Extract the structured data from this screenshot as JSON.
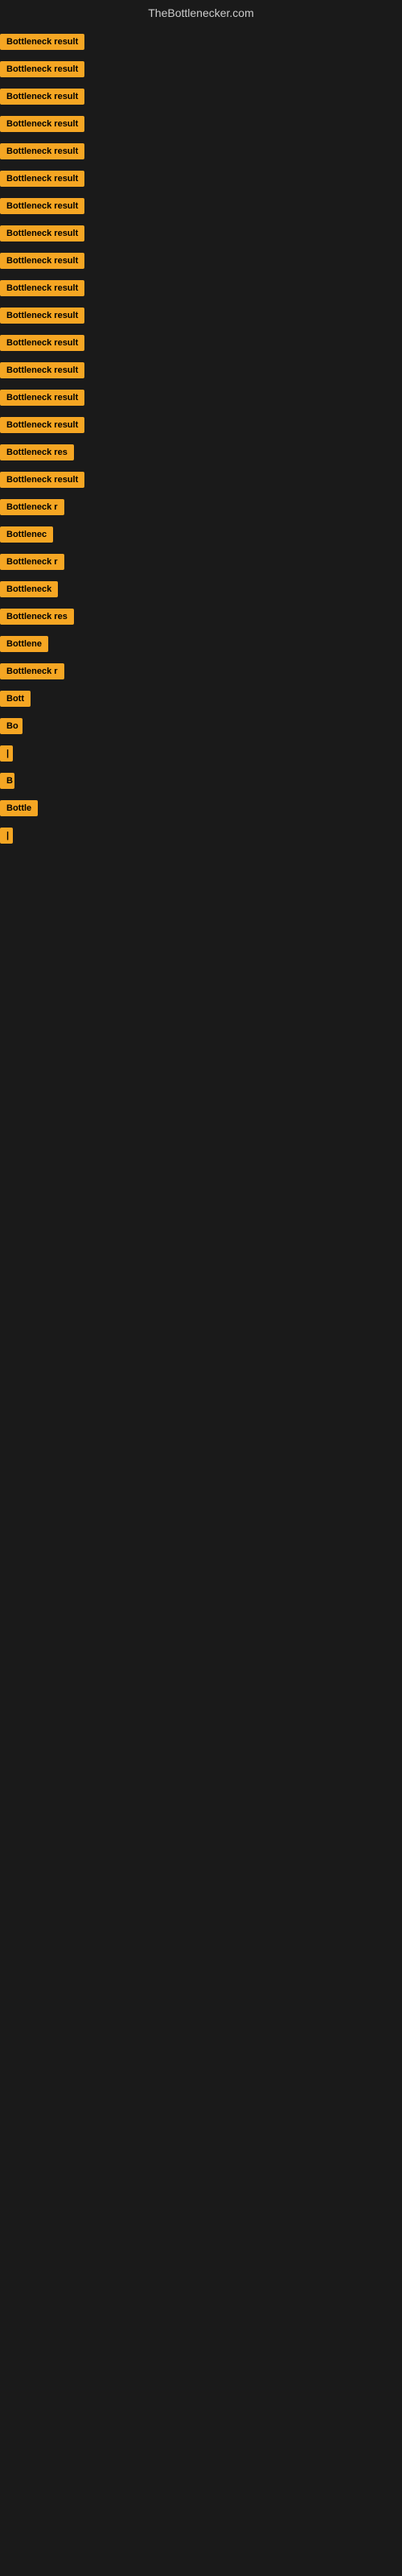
{
  "site": {
    "title": "TheBottlenecker.com"
  },
  "results": [
    {
      "label": "Bottleneck result",
      "width": 140
    },
    {
      "label": "Bottleneck result",
      "width": 138
    },
    {
      "label": "Bottleneck result",
      "width": 135
    },
    {
      "label": "Bottleneck result",
      "width": 132
    },
    {
      "label": "Bottleneck result",
      "width": 130
    },
    {
      "label": "Bottleneck result",
      "width": 128
    },
    {
      "label": "Bottleneck result",
      "width": 126
    },
    {
      "label": "Bottleneck result",
      "width": 124
    },
    {
      "label": "Bottleneck result",
      "width": 122
    },
    {
      "label": "Bottleneck result",
      "width": 120
    },
    {
      "label": "Bottleneck result",
      "width": 118
    },
    {
      "label": "Bottleneck result",
      "width": 116
    },
    {
      "label": "Bottleneck result",
      "width": 114
    },
    {
      "label": "Bottleneck result",
      "width": 112
    },
    {
      "label": "Bottleneck result",
      "width": 110
    },
    {
      "label": "Bottleneck res",
      "width": 100
    },
    {
      "label": "Bottleneck result",
      "width": 108
    },
    {
      "label": "Bottleneck r",
      "width": 90
    },
    {
      "label": "Bottlenec",
      "width": 80
    },
    {
      "label": "Bottleneck r",
      "width": 88
    },
    {
      "label": "Bottleneck",
      "width": 82
    },
    {
      "label": "Bottleneck res",
      "width": 98
    },
    {
      "label": "Bottlene",
      "width": 72
    },
    {
      "label": "Bottleneck r",
      "width": 86
    },
    {
      "label": "Bott",
      "width": 42
    },
    {
      "label": "Bo",
      "width": 28
    },
    {
      "label": "|",
      "width": 10
    },
    {
      "label": "B",
      "width": 18
    },
    {
      "label": "Bottle",
      "width": 50
    },
    {
      "label": "|",
      "width": 8
    }
  ]
}
